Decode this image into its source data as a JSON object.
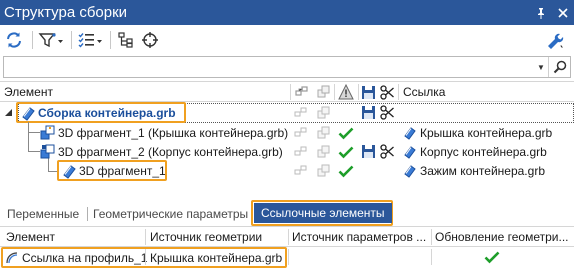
{
  "window": {
    "title": "Структура сборки"
  },
  "filter": {
    "value": ""
  },
  "tree": {
    "columns": {
      "element": "Элемент",
      "link": "Ссылка"
    },
    "rows": [
      {
        "label": "Сборка контейнера.grb",
        "link": ""
      },
      {
        "label": "3D фрагмент_1 (Крышка контейнера.grb)",
        "link": "Крышка контейнера.grb"
      },
      {
        "label": "3D фрагмент_2 (Корпус контейнера.grb)",
        "link": "Корпус контейнера.grb"
      },
      {
        "label": "3D фрагмент_1",
        "link": "Зажим контейнера.grb"
      }
    ]
  },
  "tabs": [
    {
      "label": "Переменные"
    },
    {
      "label": "Геометрические параметры"
    },
    {
      "label": "Ссылочные элементы"
    }
  ],
  "refs": {
    "columns": {
      "element": "Элемент",
      "geometry_source": "Источник геометрии",
      "params_source": "Источник параметров ...",
      "geometry_update": "Обновление геометри..."
    },
    "rows": [
      {
        "element": "Ссылка на профиль_1",
        "geometry_source": "Крышка контейнера.grb",
        "params_source": "",
        "geometry_update": true
      }
    ]
  },
  "colors": {
    "accent": "#2b579a",
    "highlight": "#f0a020",
    "check": "#1e9e2a"
  }
}
